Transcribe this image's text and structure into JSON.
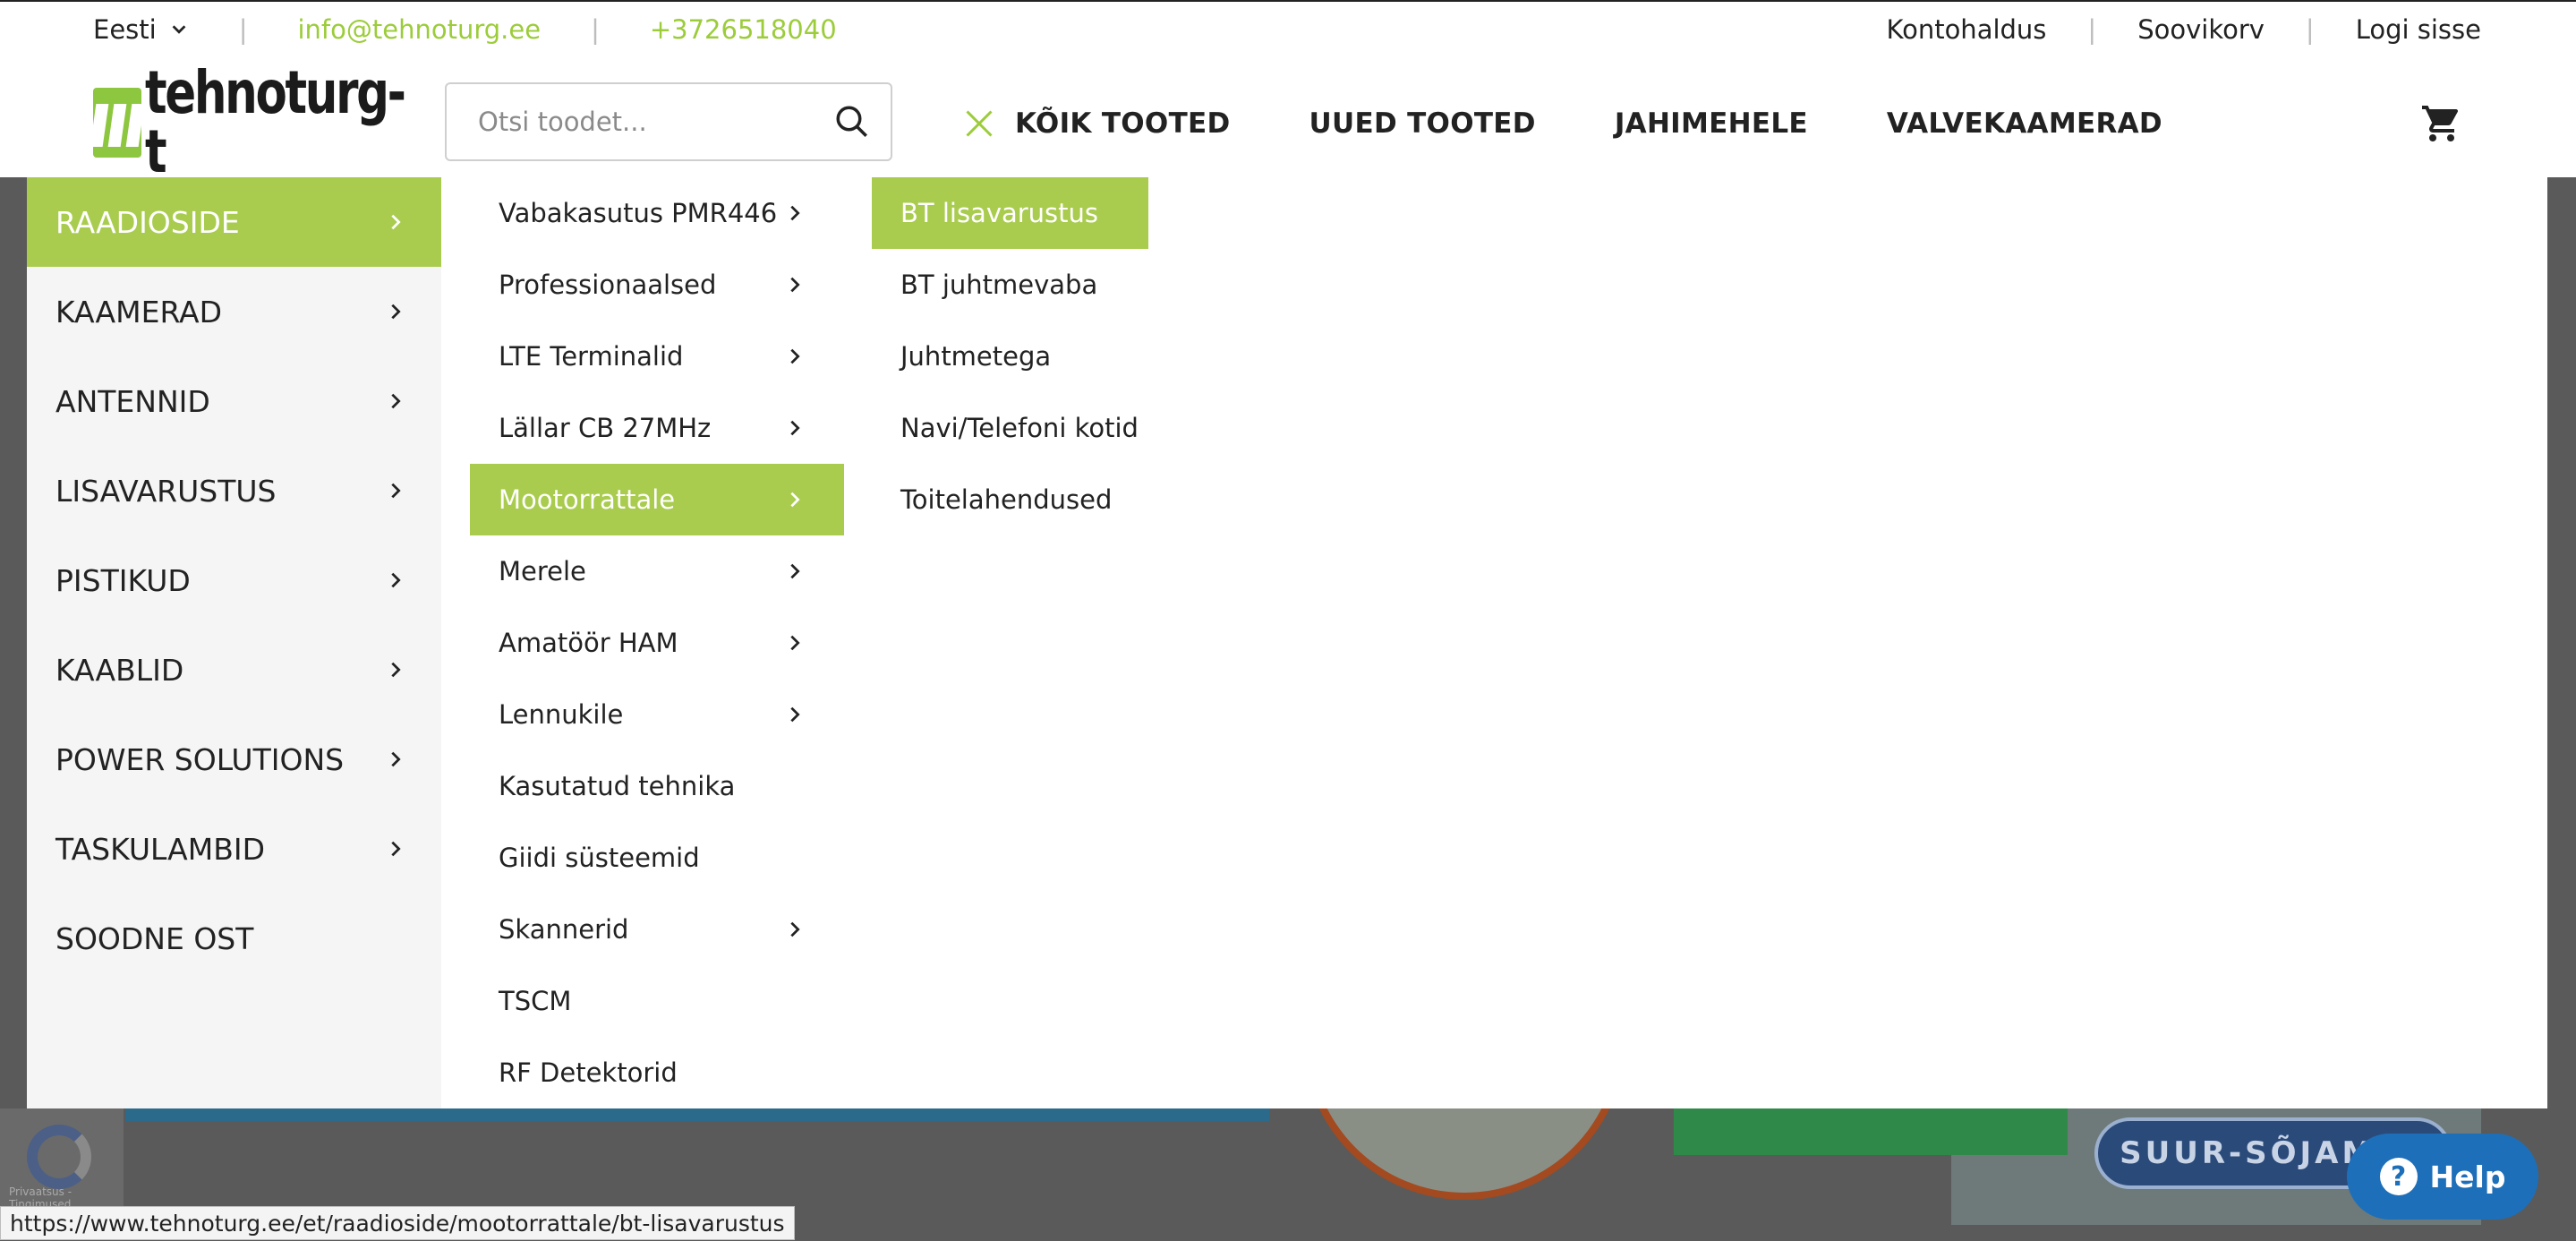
{
  "topbar": {
    "language": "Eesti",
    "email": "info@tehnoturg.ee",
    "phone": "+3726518040",
    "links": [
      "Kontohaldus",
      "Soovikorv",
      "Logi sisse"
    ]
  },
  "header": {
    "logo_text": "tehnoturg-t",
    "search_placeholder": "Otsi toodet...",
    "nav": [
      "KÕIK TOOTED",
      "UUED TOOTED",
      "JAHIMEHELE",
      "VALVEKAAMERAD"
    ]
  },
  "menu": {
    "categories": [
      {
        "label": "RAADIOSIDE",
        "arrow": true,
        "active": true
      },
      {
        "label": "KAAMERAD",
        "arrow": true
      },
      {
        "label": "ANTENNID",
        "arrow": true
      },
      {
        "label": "LISAVARUSTUS",
        "arrow": true
      },
      {
        "label": "PISTIKUD",
        "arrow": true
      },
      {
        "label": "KAABLID",
        "arrow": true
      },
      {
        "label": "POWER SOLUTIONS",
        "arrow": true
      },
      {
        "label": "TASKULAMBID",
        "arrow": true
      },
      {
        "label": "SOODNE OST",
        "arrow": false
      }
    ],
    "subcategories": [
      {
        "label": "Vabakasutus PMR446",
        "arrow": true
      },
      {
        "label": "Professionaalsed",
        "arrow": true
      },
      {
        "label": "LTE Terminalid",
        "arrow": true
      },
      {
        "label": "Lällar CB 27MHz",
        "arrow": true
      },
      {
        "label": "Mootorrattale",
        "arrow": true,
        "active": true
      },
      {
        "label": "Merele",
        "arrow": true
      },
      {
        "label": "Amatöör HAM",
        "arrow": true
      },
      {
        "label": "Lennukile",
        "arrow": true
      },
      {
        "label": "Kasutatud tehnika",
        "arrow": false
      },
      {
        "label": "Giidi süsteemid",
        "arrow": false
      },
      {
        "label": "Skannerid",
        "arrow": true
      },
      {
        "label": "TSCM",
        "arrow": false
      },
      {
        "label": "RF Detektorid",
        "arrow": false
      }
    ],
    "leaves": [
      {
        "label": "BT lisavarustus",
        "active": true
      },
      {
        "label": "BT juhtmevaba"
      },
      {
        "label": "Juhtmetega"
      },
      {
        "label": "Navi/Telefoni kotid"
      },
      {
        "label": "Toitelahendused"
      }
    ]
  },
  "background": {
    "banner_text": "SUUR-SÕJAMÄE",
    "recaptcha_text": "Privaatsus - Tingimused"
  },
  "status_url": "https://www.tehnoturg.ee/et/raadioside/mootorrattale/bt-lisavarustus",
  "help_label": "Help",
  "colors": {
    "accent_green": "#a9cc4f",
    "contact_green": "#9ccc3a",
    "help_blue": "#1e6fb9"
  }
}
